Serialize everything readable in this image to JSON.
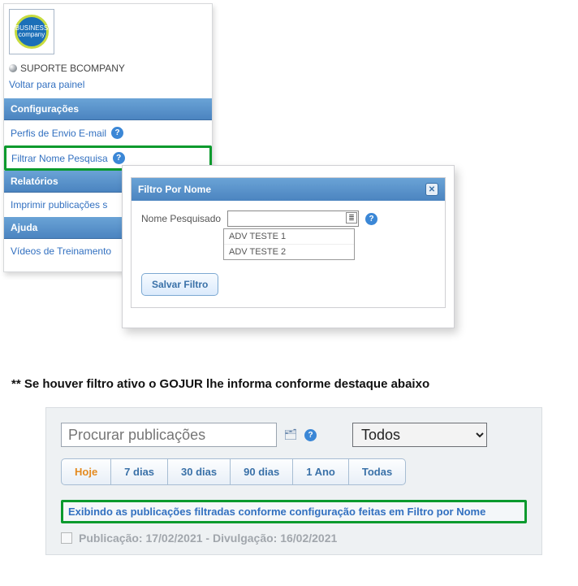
{
  "logo_text": "BUSINESS company",
  "user_name": "SUPORTE BCOMPANY",
  "back_link": "Voltar para painel",
  "sections": {
    "config_hdr": "Configurações",
    "relat_hdr": "Relatórios",
    "ajuda_hdr": "Ajuda",
    "item_perfis": "Perfis de Envio E-mail",
    "item_filtrar": "Filtrar Nome Pesquisa",
    "item_imprimir": "Imprimir publicações s",
    "item_videos": "Vídeos de Treinamento"
  },
  "popover": {
    "title": "Filtro Por Nome",
    "label_nome": "Nome Pesquisado",
    "options": [
      "ADV TESTE 1",
      "ADV TESTE 2"
    ],
    "save_btn": "Salvar Filtro"
  },
  "note_text": "** Se houver filtro ativo o GOJUR lhe informa conforme destaque abaixo",
  "bottom": {
    "search_placeholder": "Procurar publicações",
    "select_value": "Todos",
    "tabs": [
      "Hoje",
      "7 dias",
      "30 dias",
      "90 dias",
      "1 Ano",
      "Todas"
    ],
    "active_tab_index": 0,
    "banner": "Exibindo as publicações filtradas conforme configuração feitas em Filtro por Nome",
    "result_line": "Publicação: 17/02/2021 - Divulgação: 16/02/2021"
  }
}
